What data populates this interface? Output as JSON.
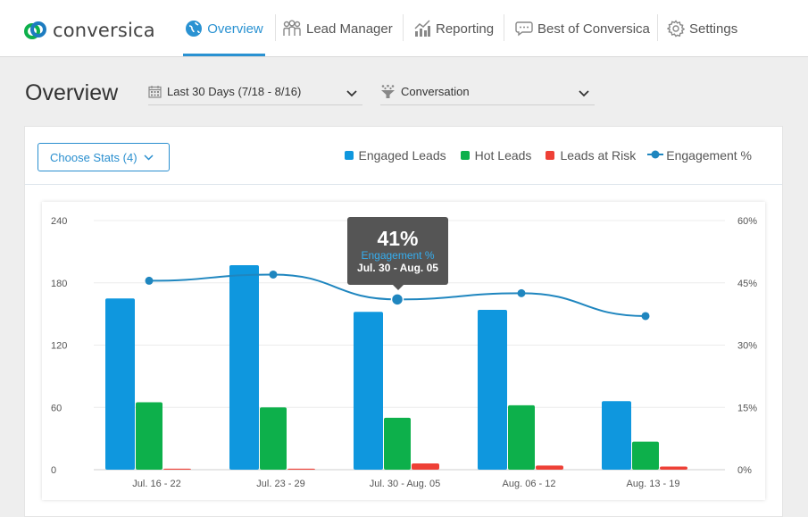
{
  "brand": {
    "name": "conversica"
  },
  "nav": {
    "items": [
      {
        "label": "Overview",
        "icon": "globe-icon",
        "active": true
      },
      {
        "label": "Lead Manager",
        "icon": "people-icon",
        "active": false
      },
      {
        "label": "Reporting",
        "icon": "chart-icon",
        "active": false
      },
      {
        "label": "Best of Conversica",
        "icon": "chat-bubble-icon",
        "active": false
      },
      {
        "label": "Settings",
        "icon": "gear-icon",
        "active": false
      }
    ]
  },
  "header": {
    "title": "Overview",
    "date_filter": {
      "value": "Last 30 Days (7/18 - 8/16)",
      "icon": "calendar-icon"
    },
    "type_filter": {
      "value": "Conversation",
      "icon": "funnel-icon"
    }
  },
  "card": {
    "choose_stats": "Choose Stats (4)",
    "legend": [
      {
        "label": "Engaged Leads",
        "color": "#0f97de"
      },
      {
        "label": "Hot Leads",
        "color": "#0db04b"
      },
      {
        "label": "Leads at Risk",
        "color": "#ee4036"
      },
      {
        "label": "Engagement %",
        "color": "#1f86bf"
      }
    ]
  },
  "tooltip": {
    "value": "41%",
    "label": "Engagement %",
    "range": "Jul. 30 - Aug. 05"
  },
  "chart_data": {
    "type": "bar",
    "categories": [
      "Jul. 16 - 22",
      "Jul. 23 - 29",
      "Jul. 30 - Aug. 05",
      "Aug. 06 - 12",
      "Aug. 13 - 19"
    ],
    "series": [
      {
        "name": "Engaged Leads",
        "type": "bar",
        "axis": "left",
        "color": "#0f97de",
        "values": [
          165,
          197,
          152,
          154,
          66
        ]
      },
      {
        "name": "Hot Leads",
        "type": "bar",
        "axis": "left",
        "color": "#0db04b",
        "values": [
          65,
          60,
          50,
          62,
          27
        ]
      },
      {
        "name": "Leads at Risk",
        "type": "bar",
        "axis": "left",
        "color": "#ee4036",
        "values": [
          1,
          1,
          6,
          4,
          3
        ]
      },
      {
        "name": "Engagement %",
        "type": "line",
        "axis": "right",
        "color": "#1f86bf",
        "values": [
          45.5,
          47,
          41,
          42.5,
          37
        ]
      }
    ],
    "y_left": {
      "min": 0,
      "max": 240,
      "ticks": [
        0,
        60,
        120,
        180,
        240
      ]
    },
    "y_right": {
      "min": 0,
      "max": 60,
      "ticks": [
        "0%",
        "15%",
        "30%",
        "45%",
        "60%"
      ]
    },
    "grid": "horizontal",
    "legend": "top-right",
    "highlighted_index": 2
  }
}
